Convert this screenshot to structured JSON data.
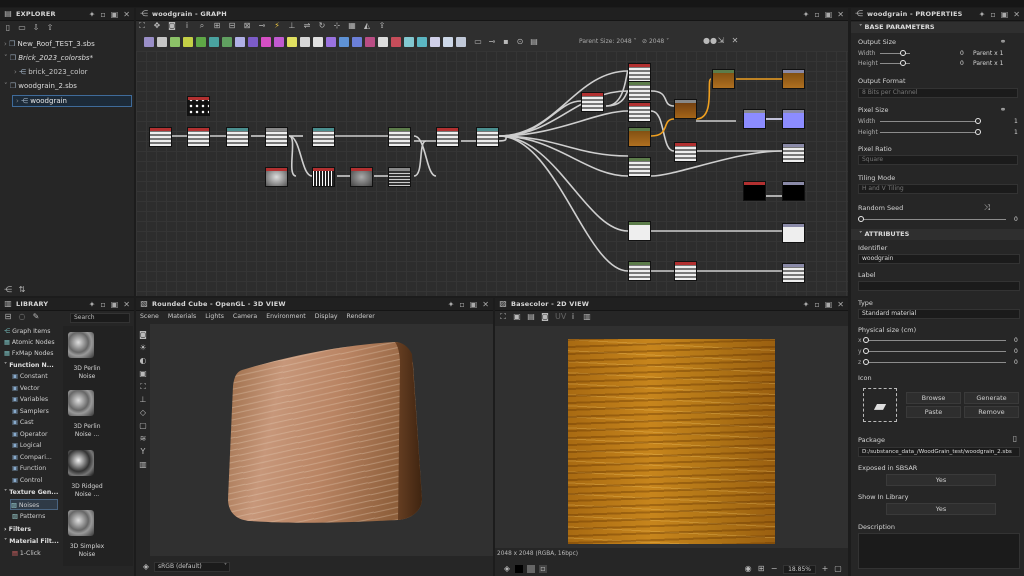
{
  "explorer": {
    "title": "EXPLORER",
    "items": [
      {
        "label": "New_Roof_TEST_3.sbs"
      },
      {
        "label": "Brick_2023_colorsbs*"
      },
      {
        "label": "brick_2023_color"
      },
      {
        "label": "woodgrain_2.sbs"
      },
      {
        "label": "woodgrain"
      }
    ]
  },
  "graph": {
    "title": "woodgrain - GRAPH",
    "parent_size_label": "Parent Size:",
    "parent_size_value": "2048",
    "output_size_value": "2048"
  },
  "library": {
    "title": "LIBRARY",
    "search_placeholder": "Search",
    "tree": [
      "Graph Items",
      "Atomic Nodes",
      "FxMap Nodes",
      "Function N...",
      "Constant",
      "Vector",
      "Variables",
      "Samplers",
      "Cast",
      "Operator",
      "Logical",
      "Compari...",
      "Function",
      "Control",
      "Texture Gen...",
      "Noises",
      "Patterns",
      "Filters",
      "Material Filt...",
      "1-Click"
    ],
    "assets": [
      "3D Perlin Noise",
      "3D Perlin Noise ...",
      "3D Ridged Noise ...",
      "3D Simplex Noise"
    ]
  },
  "view3d": {
    "title": "Rounded Cube - OpenGL - 3D VIEW",
    "menu": [
      "Scene",
      "Materials",
      "Lights",
      "Camera",
      "Environment",
      "Display",
      "Renderer"
    ],
    "colorspace": "sRGB (default)"
  },
  "view2d": {
    "title": "Basecolor - 2D VIEW",
    "status": "2048 x 2048 (RGBA, 16bpc)",
    "zoom": "18.85%"
  },
  "properties": {
    "title": "woodgrain - PROPERTIES",
    "base_section": "BASE PARAMETERS",
    "output_size": "Output Size",
    "width_label": "Width",
    "height_label": "Height",
    "width_val": "0",
    "height_val": "0",
    "parent_x1": "Parent x 1",
    "parent_y1": "Parent x 1",
    "output_format": "Output Format",
    "format_value": "8 Bits per Channel",
    "pixel_size": "Pixel Size",
    "px_width": "Width",
    "px_height": "Height",
    "px_w_val": "1",
    "px_h_val": "1",
    "pixel_ratio": "Pixel Ratio",
    "ratio_value": "Square",
    "tiling_mode": "Tiling Mode",
    "tiling_value": "H and V Tiling",
    "random_seed": "Random Seed",
    "seed_val": "0",
    "attr_section": "ATTRIBUTES",
    "identifier": "Identifier",
    "identifier_value": "woodgrain",
    "label": "Label",
    "type": "Type",
    "type_value": "Standard material",
    "physical_size": "Physical size (cm)",
    "x": "x",
    "y": "y",
    "z": "z",
    "px": "0",
    "py": "0",
    "pz": "0",
    "icon": "Icon",
    "browse": "Browse",
    "generate": "Generate",
    "paste": "Paste",
    "remove": "Remove",
    "package": "Package",
    "package_value": "D:/substance_data_/WoodGrain_test/woodgrain_2.sbs",
    "exposed": "Exposed in SBSAR",
    "exposed_value": "Yes",
    "show_lib": "Show In Library",
    "show_lib_value": "Yes",
    "description": "Description"
  }
}
